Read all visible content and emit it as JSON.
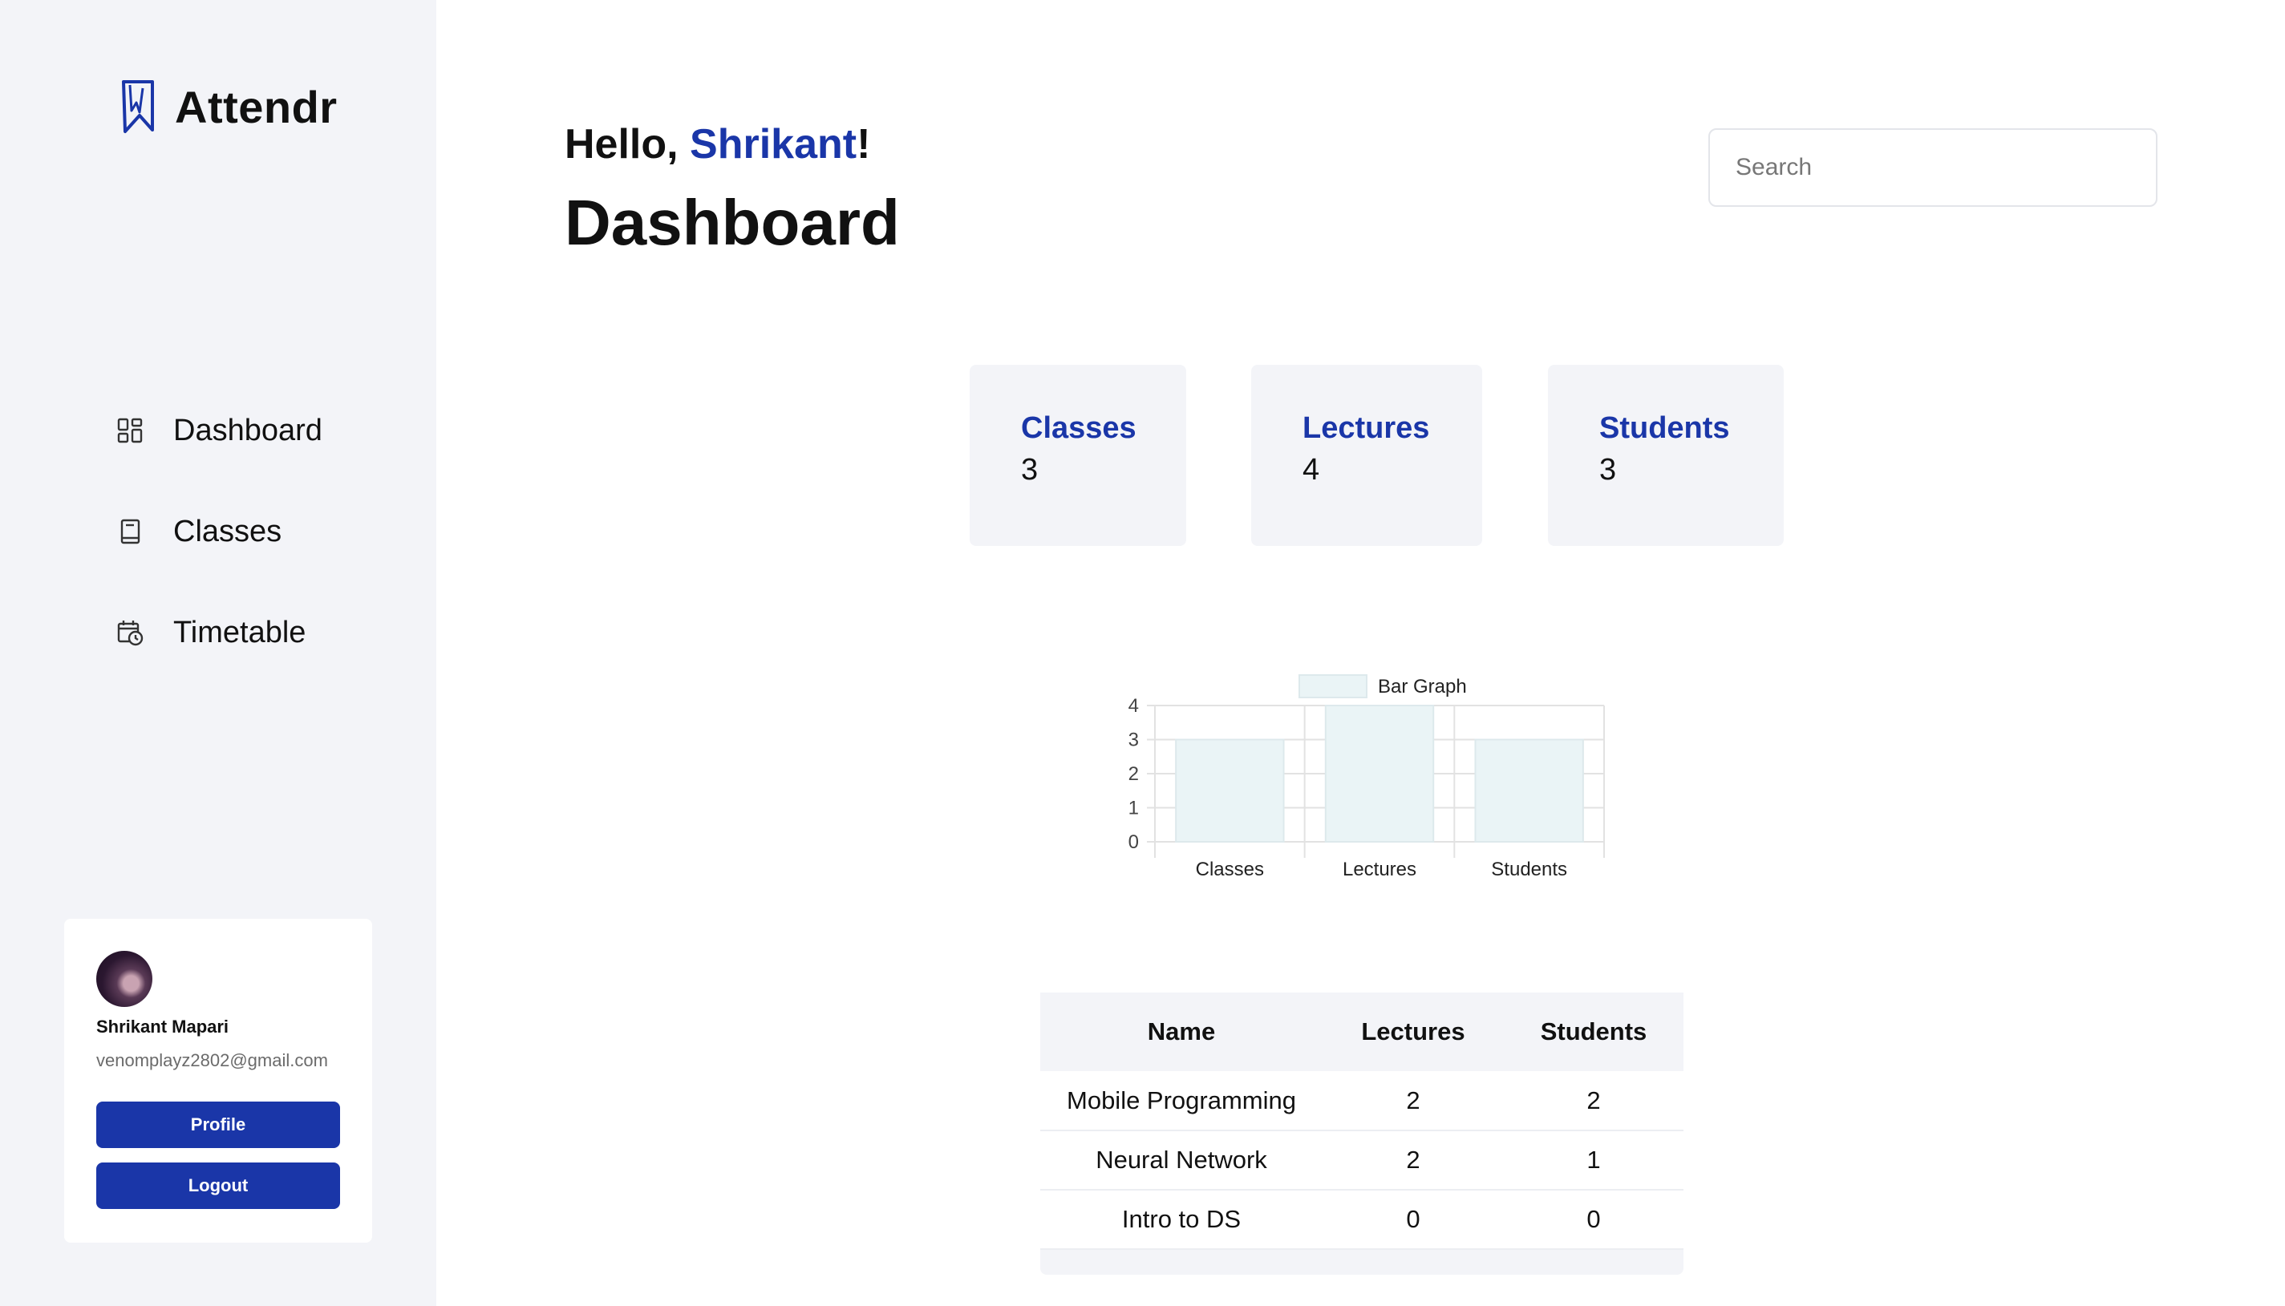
{
  "app": {
    "name": "Attendr"
  },
  "sidebar": {
    "items": [
      {
        "label": "Dashboard",
        "icon": "dashboard-grid-icon"
      },
      {
        "label": "Classes",
        "icon": "book-icon"
      },
      {
        "label": "Timetable",
        "icon": "calendar-clock-icon"
      }
    ]
  },
  "user": {
    "name": "Shrikant Mapari",
    "email": "venomplayz2802@gmail.com",
    "profile_label": "Profile",
    "logout_label": "Logout"
  },
  "header": {
    "greeting_prefix": "Hello, ",
    "greeting_name": "Shrikant",
    "greeting_suffix": "!",
    "title": "Dashboard",
    "search_placeholder": "Search"
  },
  "stats": [
    {
      "label": "Classes",
      "value": "3"
    },
    {
      "label": "Lectures",
      "value": "4"
    },
    {
      "label": "Students",
      "value": "3"
    }
  ],
  "chart_data": {
    "type": "bar",
    "categories": [
      "Classes",
      "Lectures",
      "Students"
    ],
    "series": [
      {
        "name": "Bar Graph",
        "values": [
          3,
          4,
          3
        ]
      }
    ],
    "ylim": [
      0,
      4
    ],
    "yticks": [
      "0",
      "1",
      "2",
      "3",
      "4"
    ],
    "grid": true,
    "legend": "top",
    "colors": {
      "fill": "#eaf4f6",
      "stroke": "#dde9ec",
      "grid": "#e2e2e2"
    }
  },
  "table": {
    "headers": [
      "Name",
      "Lectures",
      "Students"
    ],
    "rows": [
      [
        "Mobile Programming",
        "2",
        "2"
      ],
      [
        "Neural Network",
        "2",
        "1"
      ],
      [
        "Intro to DS",
        "0",
        "0"
      ]
    ]
  },
  "colors": {
    "accent": "#1a36a8",
    "sidebar_bg": "#f3f4f8",
    "card_bg": "#f3f4f8"
  }
}
